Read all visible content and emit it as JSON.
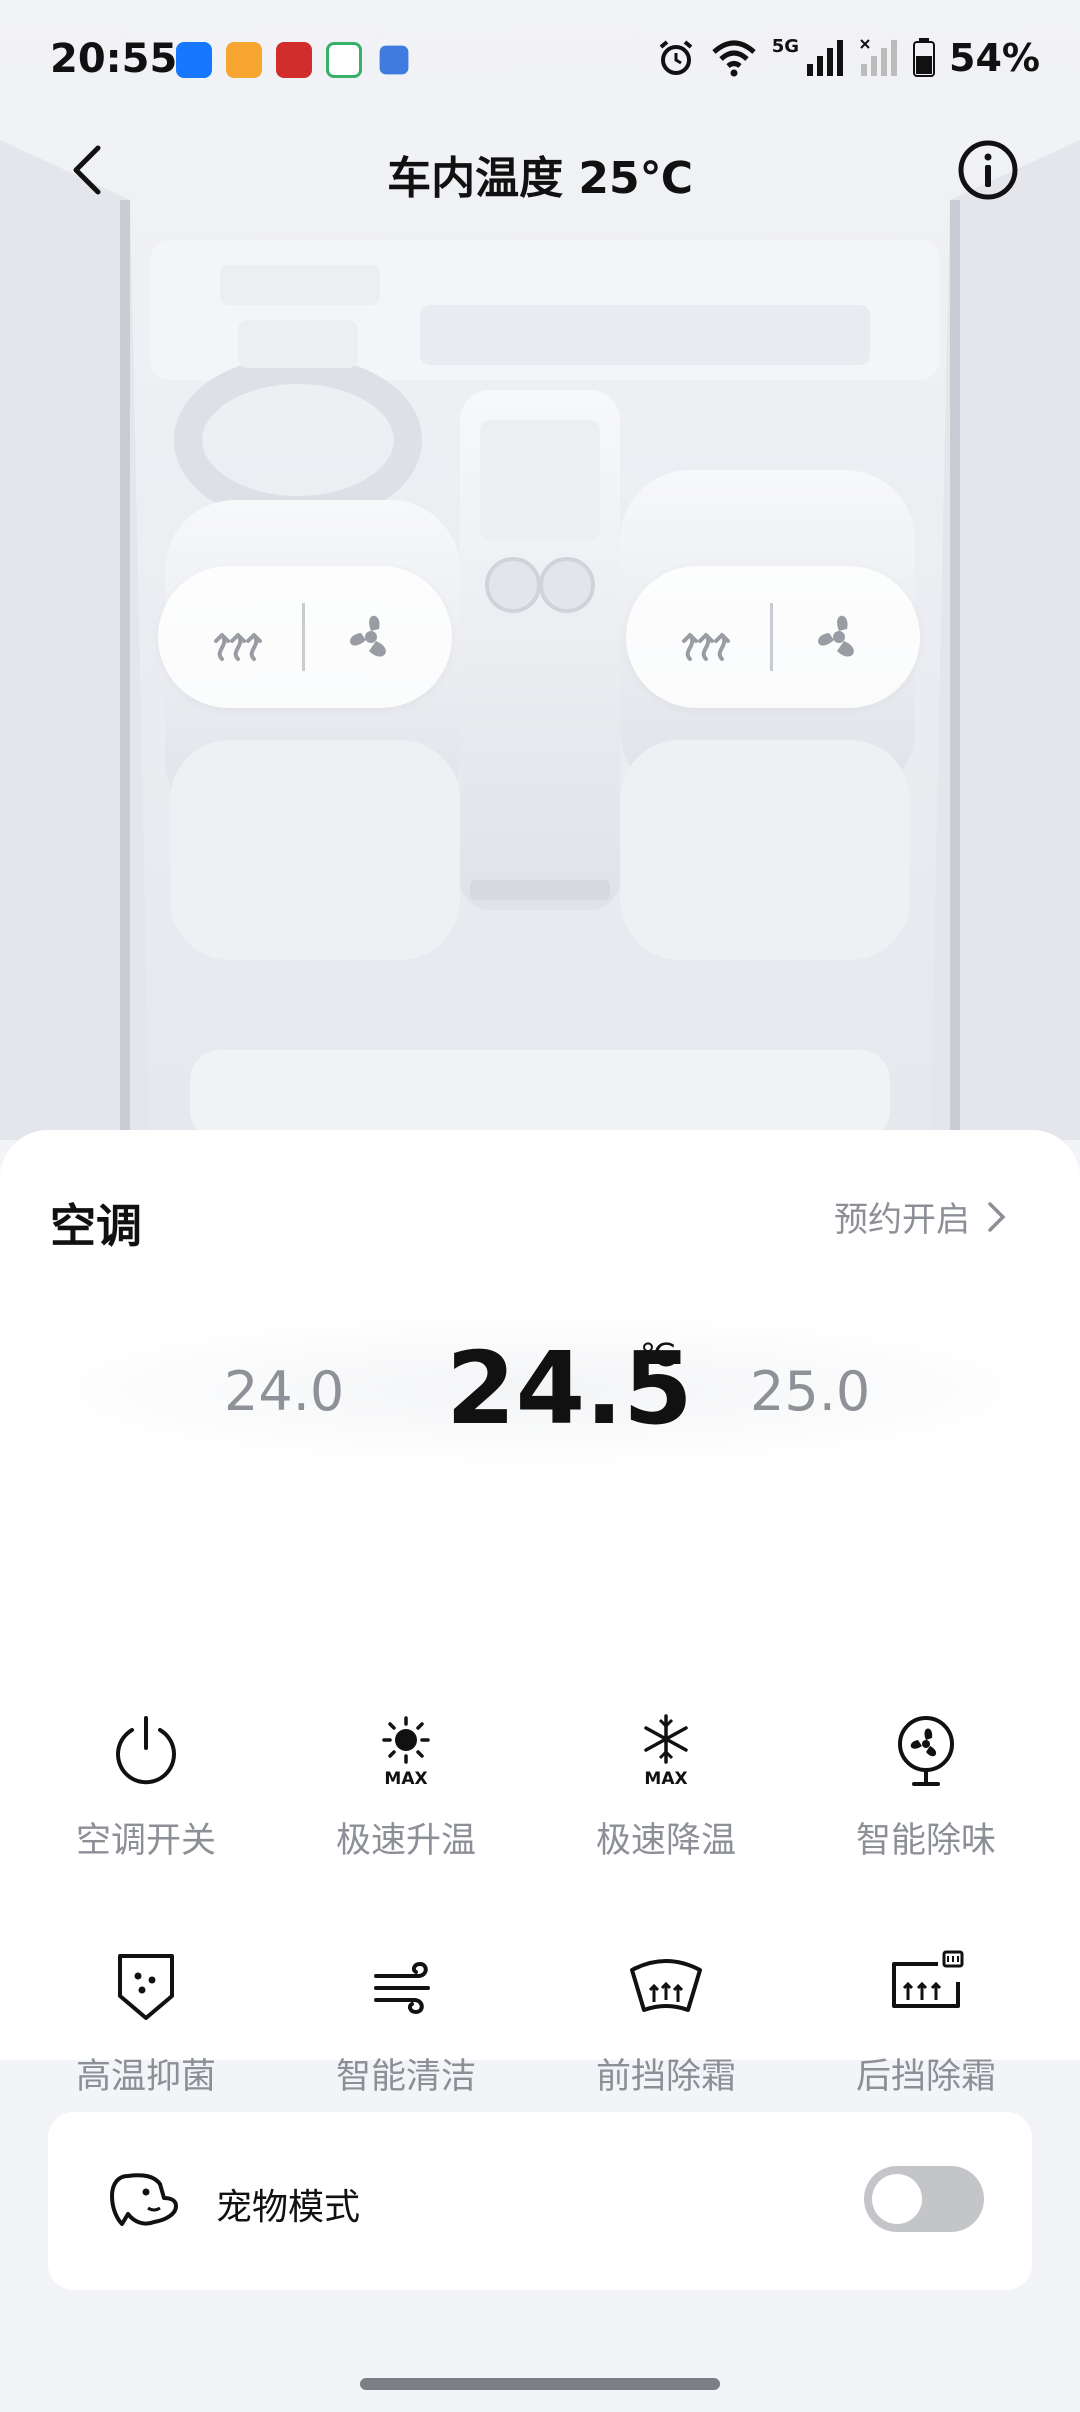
{
  "status_bar": {
    "time": "20:55",
    "network": "5G",
    "battery": "54%"
  },
  "header": {
    "title": "车内温度 25℃"
  },
  "ac": {
    "title": "空调",
    "schedule_label": "预约开启",
    "temp_lower": "24.0",
    "temp_current": "24.5",
    "temp_unit": "℃",
    "temp_upper": "25.0"
  },
  "controls": [
    {
      "label": "空调开关",
      "icon": "power-icon"
    },
    {
      "label": "极速升温",
      "icon": "sun-max-icon"
    },
    {
      "label": "极速降温",
      "icon": "snowflake-max-icon"
    },
    {
      "label": "智能除味",
      "icon": "fan-icon"
    },
    {
      "label": "高温抑菌",
      "icon": "shield-dots-icon"
    },
    {
      "label": "智能清洁",
      "icon": "wind-icon"
    },
    {
      "label": "前挡除霜",
      "icon": "front-defrost-icon"
    },
    {
      "label": "后挡除霜",
      "icon": "rear-defrost-icon"
    }
  ],
  "pet_mode": {
    "label": "宠物模式",
    "enabled": false
  },
  "colors": {
    "accent_text": "#111111",
    "muted_text": "#8c8f96",
    "toggle_off": "#c4c5c9"
  }
}
